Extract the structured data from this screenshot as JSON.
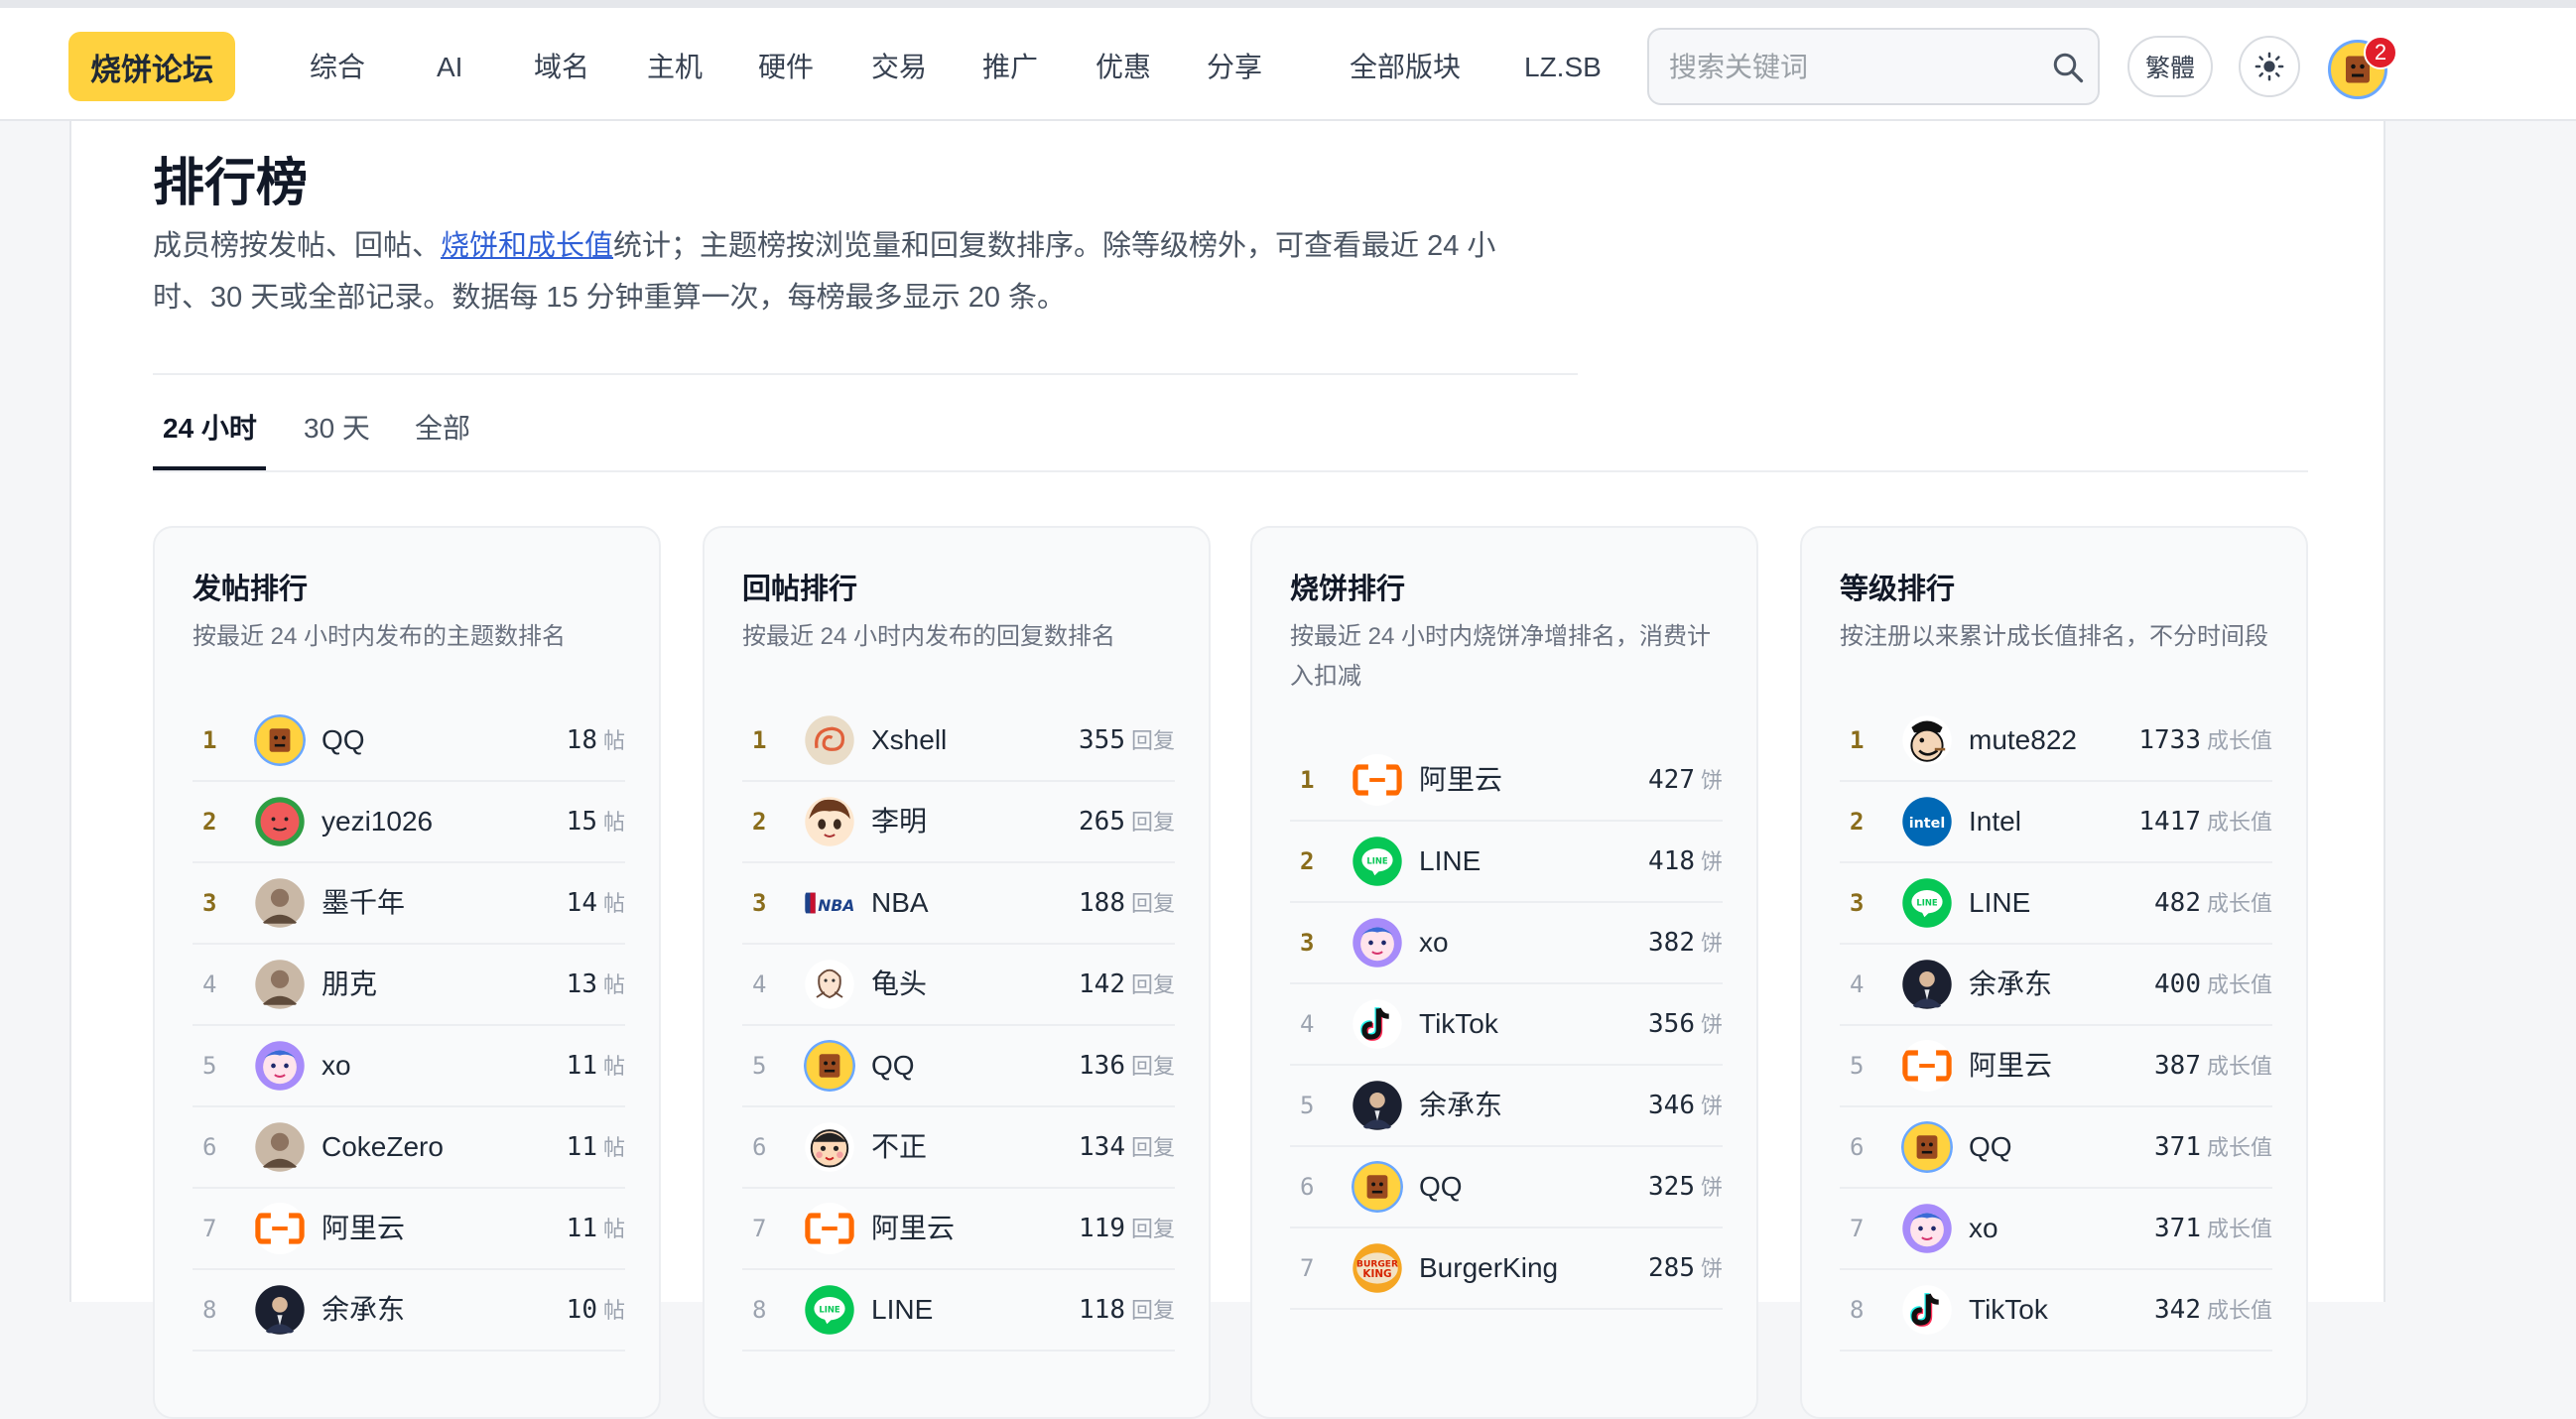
{
  "header": {
    "logo": "烧饼论坛",
    "nav": [
      "综合",
      "AI",
      "域名",
      "主机",
      "硬件",
      "交易",
      "推广",
      "优惠",
      "分享",
      "全部版块",
      "LZ.SB"
    ],
    "search_placeholder": "搜索关键词",
    "lang_toggle": "繁體",
    "notification_count": "2"
  },
  "page": {
    "title": "排行榜",
    "desc_before_link": "成员榜按发帖、回帖、",
    "desc_link": "烧饼和成长值",
    "desc_line1_after": "统计；主题榜按浏览量和回复数排序。除等级榜外，可查看最近 24 小",
    "desc_line2": "时、30 天或全部记录。数据每 15 分钟重算一次，每榜最多显示 20 条。",
    "tabs": [
      "24 小时",
      "30 天",
      "全部"
    ]
  },
  "boards": [
    {
      "title": "发帖排行",
      "subtitle": "按最近 24 小时内发布的主题数排名",
      "unit": "帖",
      "rows": [
        {
          "rank": "1",
          "name": "QQ",
          "value": "18",
          "icon": "qq-box-avatar"
        },
        {
          "rank": "2",
          "name": "yezi1026",
          "value": "15",
          "icon": "watermelon-avatar"
        },
        {
          "rank": "3",
          "name": "墨千年",
          "value": "14",
          "icon": "photo-avatar"
        },
        {
          "rank": "4",
          "name": "朋克",
          "value": "13",
          "icon": "photo-avatar"
        },
        {
          "rank": "5",
          "name": "xo",
          "value": "11",
          "icon": "cartoon-pink-avatar"
        },
        {
          "rank": "6",
          "name": "CokeZero",
          "value": "11",
          "icon": "photo-avatar"
        },
        {
          "rank": "7",
          "name": "阿里云",
          "value": "11",
          "icon": "aliyun-logo"
        },
        {
          "rank": "8",
          "name": "余承东",
          "value": "10",
          "icon": "portrait-avatar"
        }
      ]
    },
    {
      "title": "回帖排行",
      "subtitle": "按最近 24 小时内发布的回复数排名",
      "unit": "回复",
      "rows": [
        {
          "rank": "1",
          "name": "Xshell",
          "value": "355",
          "icon": "shell-logo"
        },
        {
          "rank": "2",
          "name": "李明",
          "value": "265",
          "icon": "anime-avatar"
        },
        {
          "rank": "3",
          "name": "NBA",
          "value": "188",
          "icon": "nba-logo"
        },
        {
          "rank": "4",
          "name": "龟头",
          "value": "142",
          "icon": "sketch-avatar"
        },
        {
          "rank": "5",
          "name": "QQ",
          "value": "136",
          "icon": "qq-box-avatar"
        },
        {
          "rank": "6",
          "name": "不正",
          "value": "134",
          "icon": "cartoon-boy-avatar"
        },
        {
          "rank": "7",
          "name": "阿里云",
          "value": "119",
          "icon": "aliyun-logo"
        },
        {
          "rank": "8",
          "name": "LINE",
          "value": "118",
          "icon": "line-logo"
        }
      ]
    },
    {
      "title": "烧饼排行",
      "subtitle": "按最近 24 小时内烧饼净增排名，消费计入扣减",
      "unit": "饼",
      "rows": [
        {
          "rank": "1",
          "name": "阿里云",
          "value": "427",
          "icon": "aliyun-logo"
        },
        {
          "rank": "2",
          "name": "LINE",
          "value": "418",
          "icon": "line-logo"
        },
        {
          "rank": "3",
          "name": "xo",
          "value": "382",
          "icon": "cartoon-pink-avatar"
        },
        {
          "rank": "4",
          "name": "TikTok",
          "value": "356",
          "icon": "tiktok-logo"
        },
        {
          "rank": "5",
          "name": "余承东",
          "value": "346",
          "icon": "portrait-avatar"
        },
        {
          "rank": "6",
          "name": "QQ",
          "value": "325",
          "icon": "qq-box-avatar"
        },
        {
          "rank": "7",
          "name": "BurgerKing",
          "value": "285",
          "icon": "burgerking-logo"
        }
      ]
    },
    {
      "title": "等级排行",
      "subtitle": "按注册以来累计成长值排名，不分时间段",
      "unit": "成长值",
      "rows": [
        {
          "rank": "1",
          "name": "mute822",
          "value": "1733",
          "icon": "popeye-avatar"
        },
        {
          "rank": "2",
          "name": "Intel",
          "value": "1417",
          "icon": "intel-logo"
        },
        {
          "rank": "3",
          "name": "LINE",
          "value": "482",
          "icon": "line-logo"
        },
        {
          "rank": "4",
          "name": "余承东",
          "value": "400",
          "icon": "portrait-avatar"
        },
        {
          "rank": "5",
          "name": "阿里云",
          "value": "387",
          "icon": "aliyun-logo"
        },
        {
          "rank": "6",
          "name": "QQ",
          "value": "371",
          "icon": "qq-box-avatar"
        },
        {
          "rank": "7",
          "name": "xo",
          "value": "371",
          "icon": "cartoon-pink-avatar"
        },
        {
          "rank": "8",
          "name": "TikTok",
          "value": "342",
          "icon": "tiktok-logo"
        }
      ]
    }
  ],
  "colors": {
    "logo_bg": "#ffd23f",
    "link": "#2f5fd6",
    "top_rank": "#8a6d1c",
    "badge": "#e11d2a"
  }
}
